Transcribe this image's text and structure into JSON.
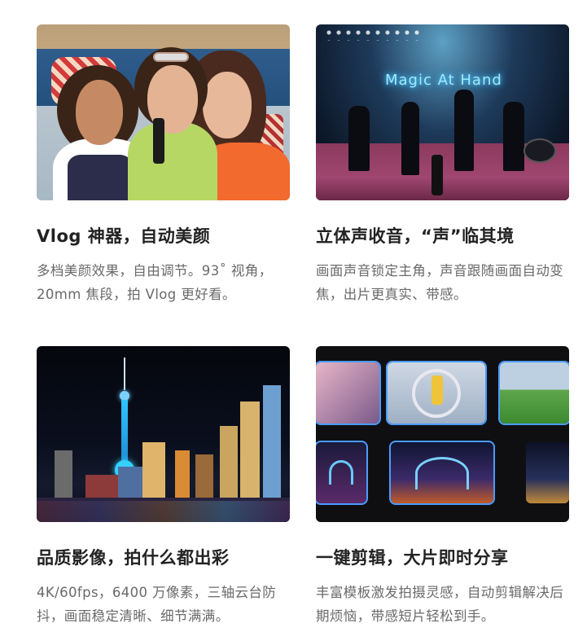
{
  "cards": [
    {
      "title": "Vlog 神器，自动美颜",
      "description": "多档美颜效果，自由调节。93˚ 视角，20mm 焦段，拍 Vlog 更好看。"
    },
    {
      "title": "立体声收音，“声”临其境",
      "description": "画面声音锁定主角，声音跟随画面自动变焦，出片更真实、带感。",
      "image_text": "Magic At Hand"
    },
    {
      "title": "品质影像，拍什么都出彩",
      "description": "4K/60fps，6400 万像素，三轴云台防抖，画面稳定清晰、细节满满。"
    },
    {
      "title": "一键剪辑，大片即时分享",
      "description": "丰富模板激发拍摄灵感，自动剪辑解决后期烦恼，带感短片轻松到手。"
    }
  ],
  "colors": {
    "title": "#222222",
    "description": "#6a6a6a",
    "accent_selection": "#4a9cff"
  }
}
